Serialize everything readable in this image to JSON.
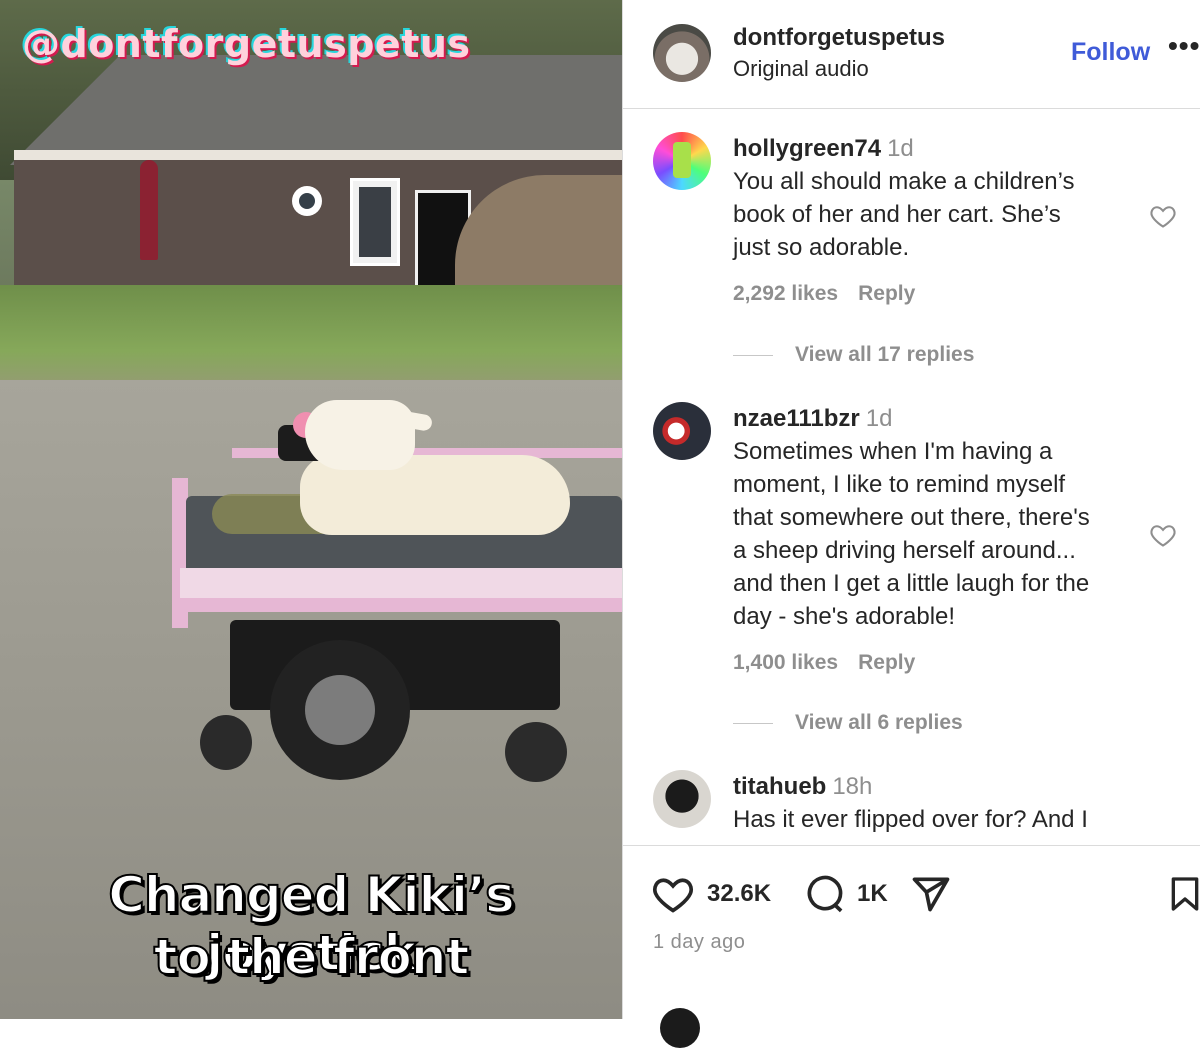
{
  "video": {
    "handle_overlay": "@dontforgetuspetus",
    "caption_line1": "Changed Kiki’s joystick",
    "caption_line2": "to the front"
  },
  "header": {
    "username": "dontforgetuspetus",
    "subtitle": "Original audio",
    "follow_label": "Follow",
    "more_label": "•••"
  },
  "comments": [
    {
      "username": "hollygreen74",
      "time": "1d",
      "lines": [
        "You all should make a children’s",
        "book of her and her cart. She’s",
        "just so adorable."
      ],
      "likes": "2,292 likes",
      "reply": "Reply",
      "view_replies": "View all 17 replies"
    },
    {
      "username": "nzae111bzr",
      "time": "1d",
      "lines": [
        "Sometimes when I'm having a",
        "moment, I like to remind myself",
        "that somewhere out there, there's",
        "a sheep driving herself around...",
        "and then I get a little laugh for the",
        "day - she's adorable!"
      ],
      "likes": "1,400 likes",
      "reply": "Reply",
      "view_replies": "View all 6 replies"
    },
    {
      "username": "titahueb",
      "time": "18h",
      "lines": [
        "Has it ever flipped over for? And I"
      ]
    }
  ],
  "actions": {
    "like_count": "32.6K",
    "comment_count": "1K",
    "posted_ago": "1 day ago"
  },
  "icons": {
    "like": "heart-icon",
    "comment": "comment-bubble-icon",
    "share": "paper-plane-icon",
    "save": "bookmark-icon"
  },
  "colors": {
    "follow_blue": "#3f5bd8",
    "meta_gray": "#8e8e8e",
    "text": "#262626"
  }
}
